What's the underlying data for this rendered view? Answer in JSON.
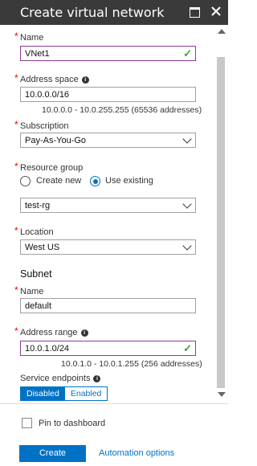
{
  "header": {
    "title": "Create virtual network",
    "maximize_icon": "maximize-icon",
    "close_icon": "close-icon",
    "close_glyph": "✕"
  },
  "form": {
    "name": {
      "label": "Name",
      "value": "VNet1"
    },
    "address_space": {
      "label": "Address space",
      "value": "10.0.0.0/16",
      "hint": "10.0.0.0 - 10.0.255.255 (65536 addresses)"
    },
    "subscription": {
      "label": "Subscription",
      "value": "Pay-As-You-Go"
    },
    "resource_group": {
      "label": "Resource group",
      "option_new": "Create new",
      "option_existing": "Use existing",
      "selected": "Use existing",
      "value": "test-rg"
    },
    "location": {
      "label": "Location",
      "value": "West US"
    }
  },
  "subnet": {
    "heading": "Subnet",
    "name": {
      "label": "Name",
      "value": "default"
    },
    "address_range": {
      "label": "Address range",
      "value": "10.0.1.0/24",
      "hint": "10.0.1.0 - 10.0.1.255 (256 addresses)"
    },
    "service_endpoints": {
      "label": "Service endpoints",
      "disabled_label": "Disabled",
      "enabled_label": "Enabled",
      "selected": "Disabled"
    }
  },
  "footer": {
    "pin_label": "Pin to dashboard",
    "create_label": "Create",
    "automation_label": "Automation options"
  },
  "glyphs": {
    "required": "*",
    "info": "i",
    "check": "✓"
  },
  "colors": {
    "header_bg": "#3a3a3a",
    "accent": "#0072c6",
    "valid_border": "#8a3a9a",
    "valid_check": "#3da33d",
    "required": "#e00000"
  }
}
